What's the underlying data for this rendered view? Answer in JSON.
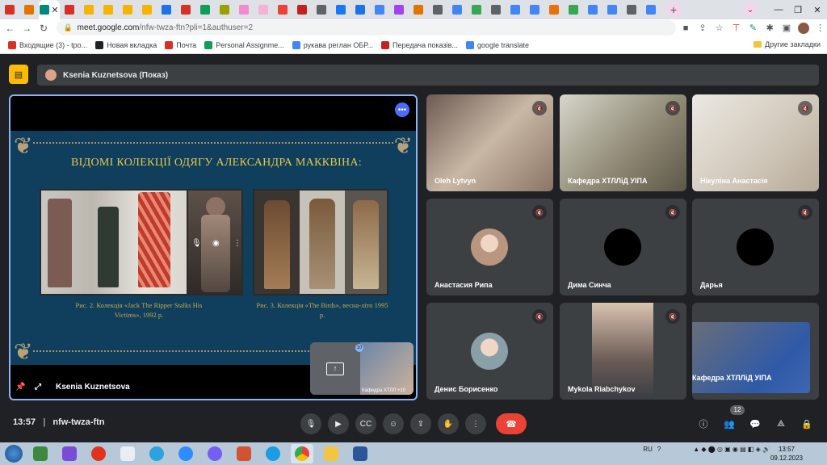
{
  "browser": {
    "url_host": "meet.google.com",
    "url_path": "/nfw-twza-ftn?pli=1&authuser=2",
    "tabs": [
      {
        "icon": "gmail-icon",
        "color": "#d93025"
      },
      {
        "icon": "photos-icon",
        "color": "#e37400"
      },
      {
        "icon": "meet-icon",
        "color": "#00897b",
        "active": true
      },
      {
        "icon": "gmail-icon",
        "color": "#d93025"
      },
      {
        "icon": "ms-icon",
        "color": "#f4b400"
      },
      {
        "icon": "ms-icon",
        "color": "#f4b400"
      },
      {
        "icon": "ms-icon",
        "color": "#f4b400"
      },
      {
        "icon": "ms-icon",
        "color": "#f4b400"
      },
      {
        "icon": "ball-icon",
        "color": "#1a73e8"
      },
      {
        "icon": "plus-icon",
        "color": "#d93025"
      },
      {
        "icon": "chat-icon",
        "color": "#0f9d58"
      },
      {
        "icon": "smile-icon",
        "color": "#9aa000"
      },
      {
        "icon": "cube-icon",
        "color": "#f28bcd"
      },
      {
        "icon": "hat-icon",
        "color": "#f6b1d4"
      },
      {
        "icon": "heart-icon",
        "color": "#ea4335"
      },
      {
        "icon": "record-icon",
        "color": "#c5221f"
      },
      {
        "icon": "grid-icon",
        "color": "#5f6368"
      },
      {
        "icon": "facebook-icon",
        "color": "#1877f2"
      },
      {
        "icon": "diamond-icon",
        "color": "#1a73e8"
      },
      {
        "icon": "puzzle-icon",
        "color": "#4285f4"
      },
      {
        "icon": "puzzle-icon",
        "color": "#a142f4"
      },
      {
        "icon": "flag-icon",
        "color": "#e37400"
      },
      {
        "icon": "grid-icon",
        "color": "#5f6368"
      },
      {
        "icon": "google-icon",
        "color": "#4285f4"
      },
      {
        "icon": "percent-icon",
        "color": "#34a853"
      },
      {
        "icon": "bank-icon",
        "color": "#5f6368"
      },
      {
        "icon": "google-icon",
        "color": "#4285f4"
      },
      {
        "icon": "google-icon",
        "color": "#4285f4"
      },
      {
        "icon": "paw-icon",
        "color": "#e8710a"
      },
      {
        "icon": "maps-icon",
        "color": "#34a853"
      },
      {
        "icon": "google-icon",
        "color": "#4285f4"
      },
      {
        "icon": "google-icon",
        "color": "#4285f4"
      },
      {
        "icon": "globe-icon",
        "color": "#5f6368"
      },
      {
        "icon": "google-icon",
        "color": "#4285f4"
      }
    ],
    "bookmarks": [
      {
        "label": "Входящие (3) - tpo...",
        "color": "#d93025"
      },
      {
        "label": "Новая вкладка",
        "color": "#202124"
      },
      {
        "label": "Почта",
        "color": "#d93025"
      },
      {
        "label": "Personal Assignme...",
        "color": "#0f9d58"
      },
      {
        "label": "рукава реглан ОБР...",
        "color": "#4285f4"
      },
      {
        "label": "Передача показів...",
        "color": "#c5221f"
      },
      {
        "label": "google translate",
        "color": "#4285f4"
      }
    ],
    "other_bookmarks": "Другие закладки"
  },
  "meet": {
    "presenter_label": "Ksenia Kuznetsova (Показ)",
    "stage": {
      "slide_title": "ВІДОМІ КОЛЕКЦІЇ ОДЯГУ АЛЕКСАНДРА МАККВІНА:",
      "caption1": "Рис. 2. Колекція «Jack The Ripper Stalks His Victims», 1992 р.",
      "caption2": "Рис. 3. Колекція «The Birds», весна-літо 1995 р.",
      "presenter_name": "Ksenia Kuznetsova",
      "self_label": "Кафедра ХТЛЛ +10",
      "self_badge": "10"
    },
    "tiles": [
      {
        "name": "Oleh Lytvyn",
        "kind": "video",
        "bg": "linear-gradient(135deg,#6d5a52,#c9b8a5 50%,#8a7565)"
      },
      {
        "name": "Кафедра ХТЛЛіД УІПА",
        "kind": "video",
        "bg": "linear-gradient(135deg,#d7d6c9,#8b8571 60%,#5d5748)"
      },
      {
        "name": "Нікуліна Анастасія",
        "kind": "video",
        "bg": "linear-gradient(135deg,#ece9e3,#cfc6b8 60%,#b6a997)"
      },
      {
        "name": "Анастасия Рипа",
        "kind": "avatar-photo",
        "bg": "#3c4043",
        "avatar": "#b89680"
      },
      {
        "name": "Дима Синча",
        "kind": "avatar-black",
        "bg": "#3c4043"
      },
      {
        "name": "Дарья",
        "kind": "avatar-black",
        "bg": "#3c4043"
      },
      {
        "name": "Денис Борисенко",
        "kind": "avatar-photo",
        "bg": "#3c4043",
        "avatar": "#8aa0a8"
      },
      {
        "name": "Mykola Riabchykov",
        "kind": "video-partial",
        "bg": "#3c4043"
      },
      {
        "name": "Кафедра ХТЛЛіД УІПА",
        "kind": "video-float",
        "bg": "#3c4043"
      }
    ],
    "bottom": {
      "time": "13:57",
      "meeting_code": "nfw-twza-ftn",
      "people_count": "12"
    }
  },
  "taskbar": {
    "lang": "RU",
    "time": "13:57",
    "date": "09.12.2023"
  }
}
